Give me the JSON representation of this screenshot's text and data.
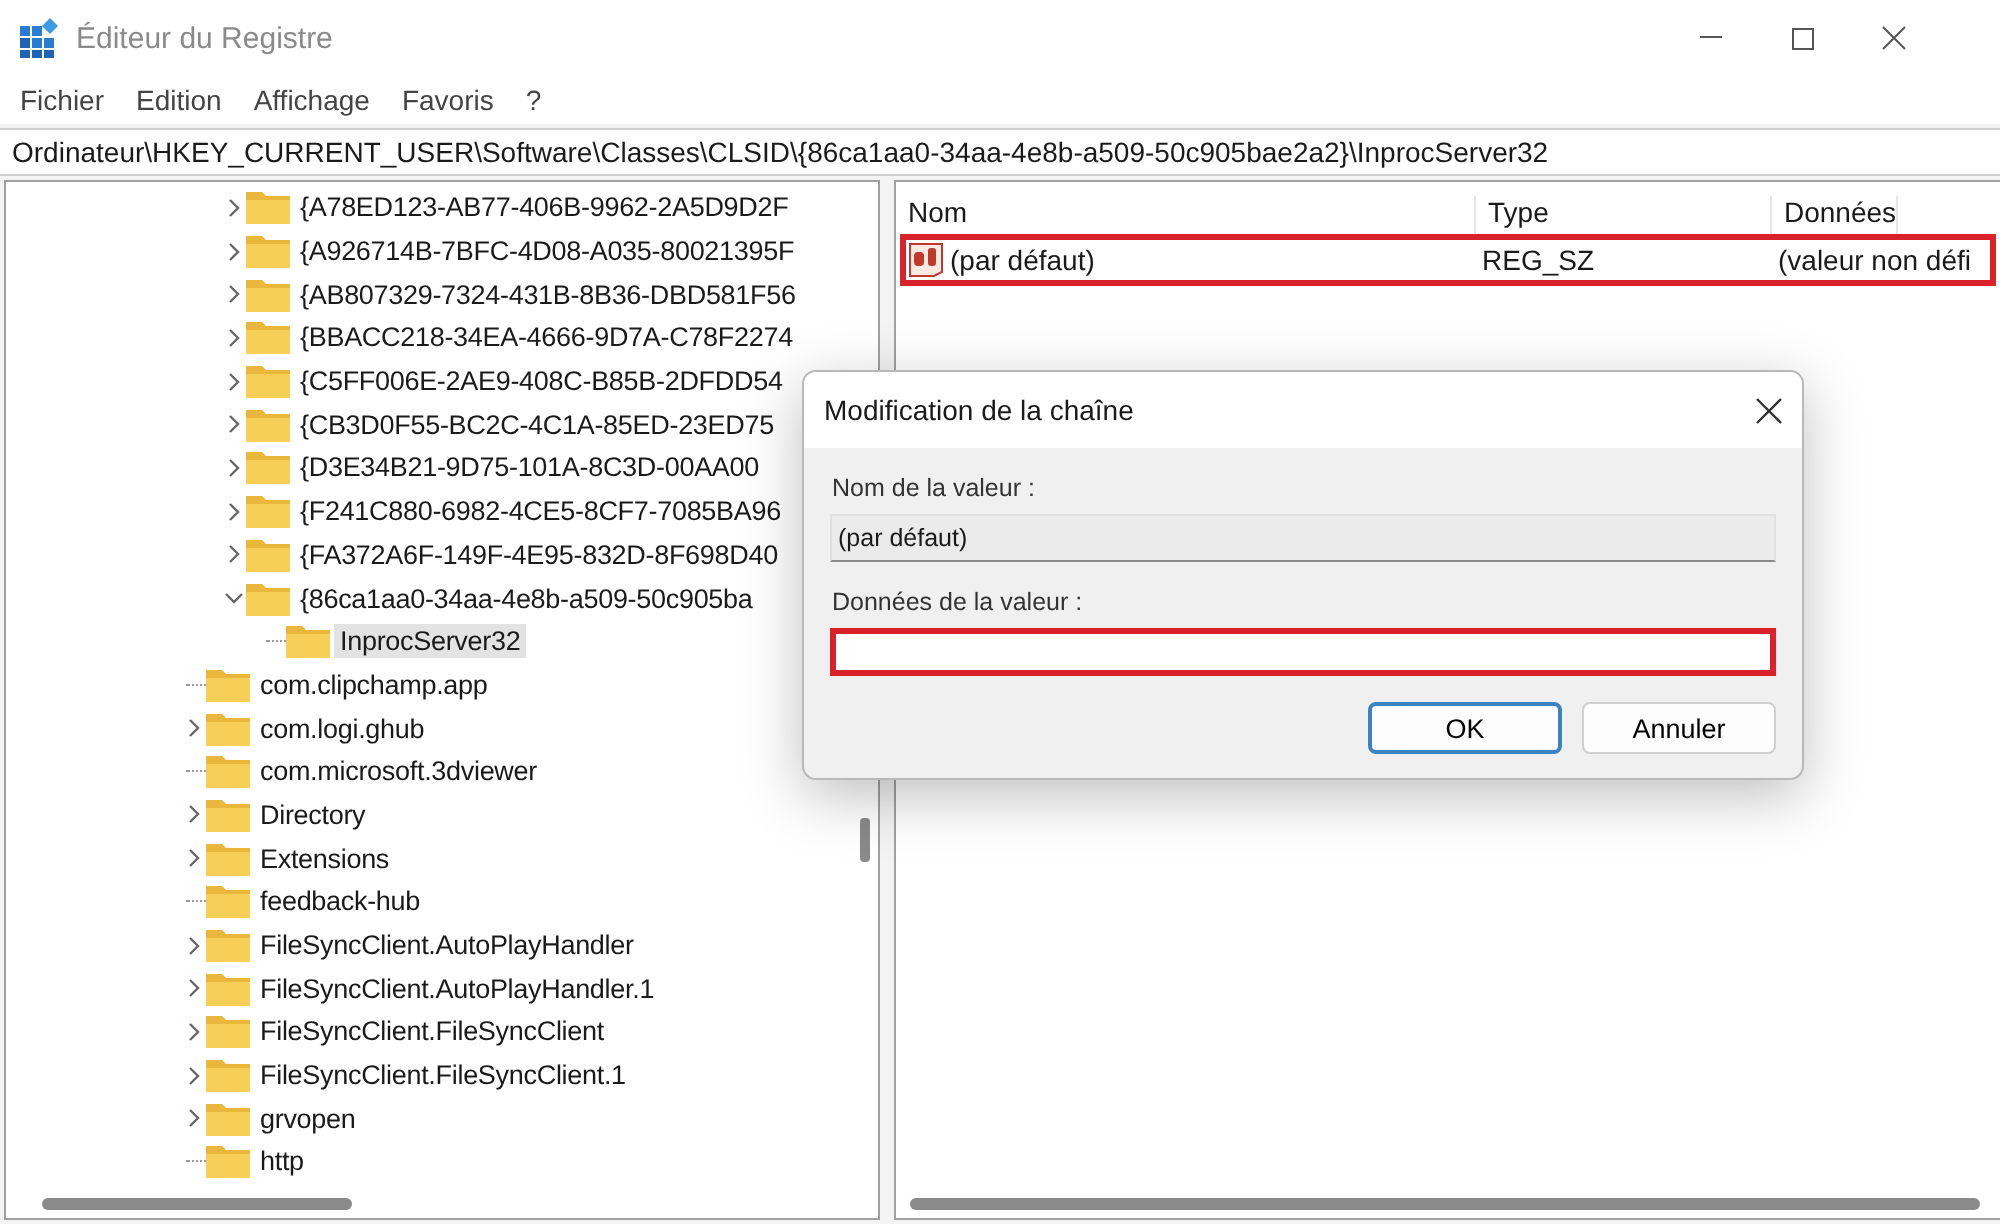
{
  "window": {
    "title": "Éditeur du Registre"
  },
  "menu": [
    "Fichier",
    "Edition",
    "Affichage",
    "Favoris",
    "?"
  ],
  "address": "Ordinateur\\HKEY_CURRENT_USER\\Software\\Classes\\CLSID\\{86ca1aa0-34aa-4e8b-a509-50c905bae2a2}\\InprocServer32",
  "tree": {
    "items": [
      {
        "children": [
          {
            "label": "{A78ED123-AB77-406B-9962-2A5D9D2F",
            "expandable": true,
            "expanded": false,
            "selected": false
          },
          {
            "label": "{A926714B-7BFC-4D08-A035-80021395F",
            "expandable": true,
            "expanded": false,
            "selected": false
          },
          {
            "label": "{AB807329-7324-431B-8B36-DBD581F56",
            "expandable": true,
            "expanded": false,
            "selected": false
          },
          {
            "label": "{BBACC218-34EA-4666-9D7A-C78F2274",
            "expandable": true,
            "expanded": false,
            "selected": false
          },
          {
            "label": "{C5FF006E-2AE9-408C-B85B-2DFDD54",
            "expandable": true,
            "expanded": false,
            "selected": false
          },
          {
            "label": "{CB3D0F55-BC2C-4C1A-85ED-23ED75",
            "expandable": true,
            "expanded": false,
            "selected": false
          },
          {
            "label": "{D3E34B21-9D75-101A-8C3D-00AA00",
            "expandable": true,
            "expanded": false,
            "selected": false
          },
          {
            "label": "{F241C880-6982-4CE5-8CF7-7085BA96",
            "expandable": true,
            "expanded": false,
            "selected": false
          },
          {
            "label": "{FA372A6F-149F-4E95-832D-8F698D40",
            "expandable": true,
            "expanded": false,
            "selected": false
          },
          {
            "label": "{86ca1aa0-34aa-4e8b-a509-50c905ba",
            "expandable": true,
            "expanded": true,
            "selected": false,
            "children": [
              {
                "label": "InprocServer32",
                "expandable": false,
                "selected": true
              }
            ]
          }
        ]
      },
      {
        "label": "com.clipchamp.app",
        "expandable": false,
        "selected": false
      },
      {
        "label": "com.logi.ghub",
        "expandable": true,
        "expanded": false,
        "selected": false
      },
      {
        "label": "com.microsoft.3dviewer",
        "expandable": false,
        "selected": false
      },
      {
        "label": "Directory",
        "expandable": true,
        "expanded": false,
        "selected": false
      },
      {
        "label": "Extensions",
        "expandable": true,
        "expanded": false,
        "selected": false
      },
      {
        "label": "feedback-hub",
        "expandable": false,
        "selected": false
      },
      {
        "label": "FileSyncClient.AutoPlayHandler",
        "expandable": true,
        "expanded": false,
        "selected": false
      },
      {
        "label": "FileSyncClient.AutoPlayHandler.1",
        "expandable": true,
        "expanded": false,
        "selected": false
      },
      {
        "label": "FileSyncClient.FileSyncClient",
        "expandable": true,
        "expanded": false,
        "selected": false
      },
      {
        "label": "FileSyncClient.FileSyncClient.1",
        "expandable": true,
        "expanded": false,
        "selected": false
      },
      {
        "label": "grvopen",
        "expandable": true,
        "expanded": false,
        "selected": false
      },
      {
        "label": "http",
        "expandable": false,
        "selected": false
      }
    ]
  },
  "values": {
    "columns": [
      "Nom",
      "Type",
      "Données"
    ],
    "rows": [
      {
        "name": "(par défaut)",
        "type": "REG_SZ",
        "data": "(valeur non défi",
        "highlighted": true
      }
    ]
  },
  "dialog": {
    "title": "Modification de la chaîne",
    "name_label": "Nom de la valeur :",
    "name_value": "(par défaut)",
    "data_label": "Données de la valeur :",
    "data_highlighted": true,
    "buttons": [
      {
        "label": "OK",
        "default": true
      },
      {
        "label": "Annuler",
        "default": false
      }
    ]
  }
}
